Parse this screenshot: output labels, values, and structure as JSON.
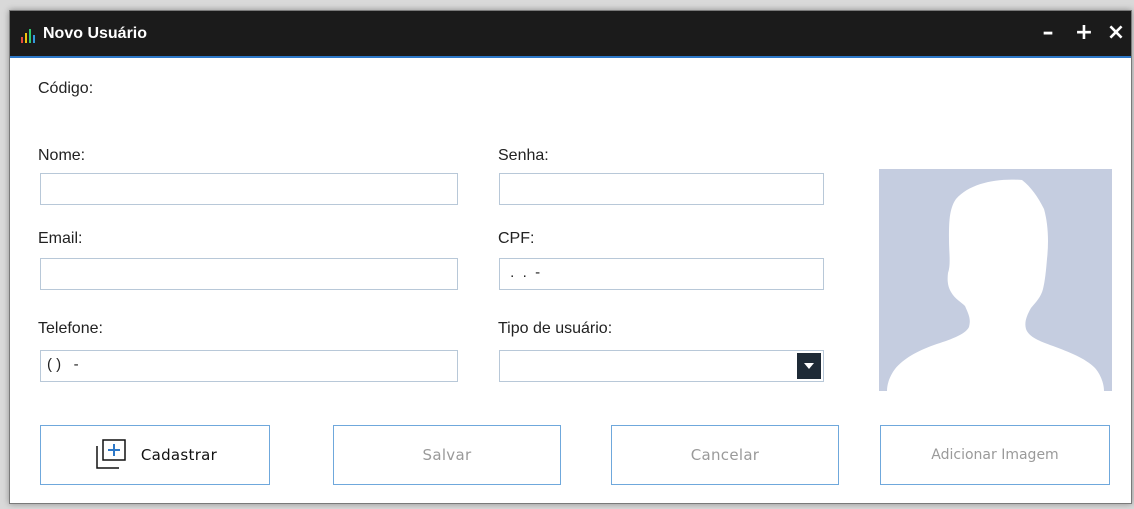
{
  "window": {
    "title": "Novo Usuário",
    "controls": {
      "minimize": "–",
      "maximize": "+",
      "close": "×"
    }
  },
  "form": {
    "codigo_label": "Código:",
    "nome": {
      "label": "Nome:",
      "value": ""
    },
    "senha": {
      "label": "Senha:",
      "value": ""
    },
    "email": {
      "label": "Email:",
      "value": ""
    },
    "cpf": {
      "label": "CPF:",
      "value": " .  .  -"
    },
    "telefone": {
      "label": "Telefone:",
      "value": "( )   -"
    },
    "tipo_usuario": {
      "label": "Tipo de usuário:",
      "value": ""
    }
  },
  "buttons": {
    "cadastrar": "Cadastrar",
    "salvar": "Salvar",
    "cancelar": "Cancelar",
    "adicionar_imagem": "Adicionar Imagem"
  },
  "icons": {
    "app": "bar-chart-icon",
    "select": "caret-down-icon",
    "cadastrar": "add-square-icon",
    "avatar": "person-silhouette-icon"
  },
  "colors": {
    "titlebar": "#1b1b1b",
    "accent": "#2d78c8",
    "field_border": "#b8c8d8",
    "button_border": "#6fa8dc",
    "avatar_bg": "#c5cde0",
    "disabled_text": "#9a9a9a"
  }
}
